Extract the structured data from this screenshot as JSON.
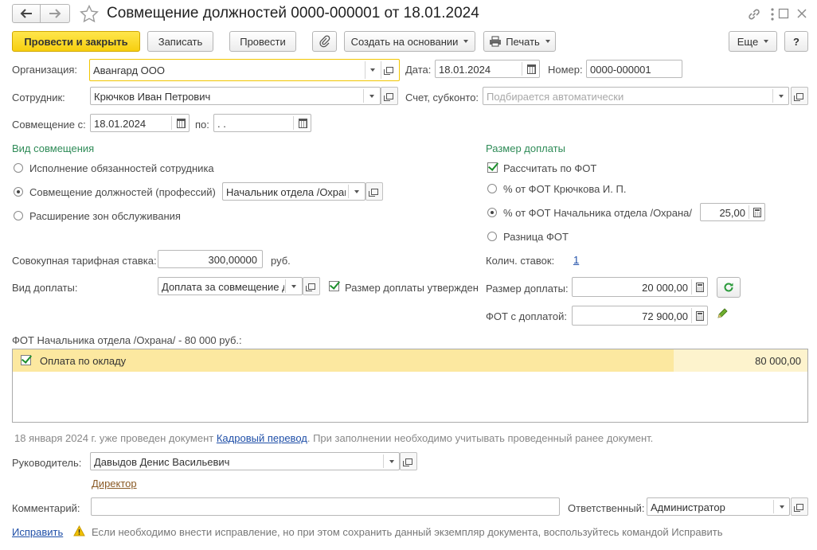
{
  "header": {
    "title": "Совмещение должностей 0000-000001 от 18.01.2024"
  },
  "toolbar": {
    "post_close": "Провести и закрыть",
    "save": "Записать",
    "post": "Провести",
    "create_based_on": "Создать на основании",
    "print": "Печать",
    "more": "Еще",
    "help": "?"
  },
  "form": {
    "org_label": "Организация:",
    "org_value": "Авангард ООО",
    "date_label": "Дата:",
    "date_value": "18.01.2024",
    "number_label": "Номер:",
    "number_value": "0000-000001",
    "employee_label": "Сотрудник:",
    "employee_value": "Крючков Иван Петрович",
    "account_label": "Счет, субконто:",
    "account_placeholder": "Подбирается автоматически",
    "from_label": "Совмещение с:",
    "from_value": "18.01.2024",
    "to_label": "по:",
    "to_value": " .  .",
    "kind_title": "Вид совмещения",
    "kind_options": [
      "Исполнение обязанностей сотрудника",
      "Совмещение должностей (профессий)",
      "Расширение зон обслуживания"
    ],
    "kind_position_value": "Начальник отдела /Охрана/",
    "surcharge_title": "Размер доплаты",
    "calc_by_fot": "Рассчитать по ФОТ",
    "surcharge_options": [
      "% от ФОТ Крючкова И. П.",
      "% от ФОТ Начальника отдела /Охрана/",
      "Разница ФОТ"
    ],
    "percent_value": "25,00",
    "tariff_label": "Совокупная тарифная ставка:",
    "tariff_value": "300,00000",
    "tariff_unit": "руб.",
    "rates_label": "Колич. ставок:",
    "rates_value": "1",
    "surcharge_kind_label": "Вид доплаты:",
    "surcharge_kind_value": "Доплата за совмещение должностей",
    "approved_label": "Размер доплаты утвержден",
    "surcharge_amount_label": "Размер доплаты:",
    "surcharge_amount_value": "20 000,00",
    "fot_with_label": "ФОТ с доплатой:",
    "fot_with_value": "72 900,00",
    "fot_caption": "ФОТ Начальника отдела /Охрана/ - 80 000 руб.:",
    "table_rows": [
      {
        "name": "Оплата по окладу",
        "amount": "80 000,00"
      }
    ],
    "info_prefix": "18 января 2024 г. уже проведен документ",
    "info_link": "Кадровый перевод",
    "info_suffix": ". При заполнении необходимо учитывать проведенный ранее документ.",
    "manager_label": "Руководитель:",
    "manager_value": "Давыдов Денис Васильевич",
    "manager_position": "Директор",
    "comment_label": "Комментарий:",
    "comment_value": "",
    "responsible_label": "Ответственный:",
    "responsible_value": "Администратор",
    "fix_link": "Исправить",
    "fix_warning": "Если необходимо внести исправление, но при этом сохранить данный экземпляр документа, воспользуйтесь командой Исправить"
  }
}
